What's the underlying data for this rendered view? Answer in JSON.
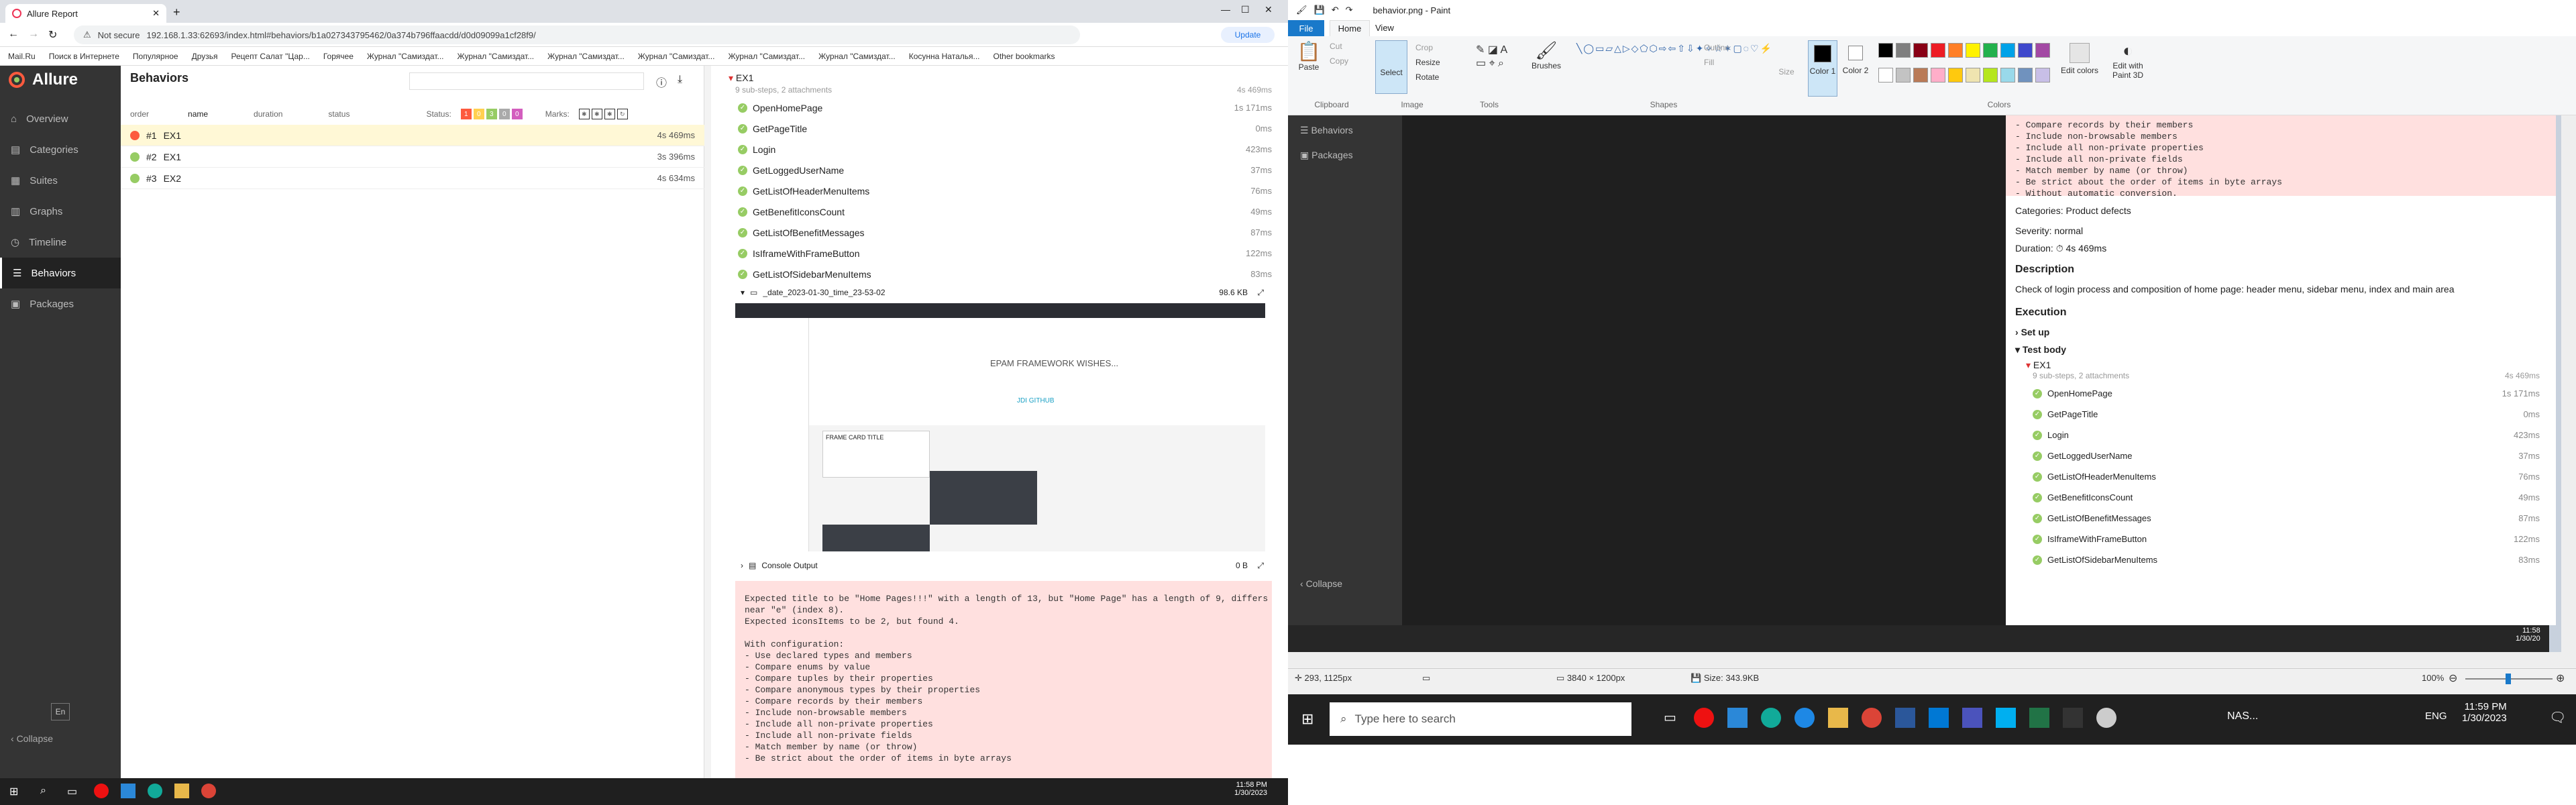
{
  "browser": {
    "tab_title": "Allure Report",
    "url_prefix": "Not secure",
    "url": "192.168.1.33:62693/index.html#behaviors/b1a027343795462/0a374b796ffaacdd/d0d09099a1cf28f9/",
    "update_label": "Update",
    "bookmarks": [
      "Mail.Ru",
      "Поиск в Интернете",
      "Популярное",
      "Друзья",
      "Рецепт Салат \"Цар...",
      "Горячее",
      "Журнал \"Самиздат...",
      "Журнал \"Самиздат...",
      "Журнал \"Самиздат...",
      "Журнал \"Самиздат...",
      "Журнал \"Самиздат...",
      "Журнал \"Самиздат...",
      "Косунна Наталья...",
      "Other bookmarks"
    ]
  },
  "allure": {
    "brand": "Allure",
    "nav": [
      "Overview",
      "Categories",
      "Suites",
      "Graphs",
      "Timeline",
      "Behaviors",
      "Packages"
    ],
    "active_nav": "Behaviors",
    "lang": "En",
    "collapse": "Collapse",
    "behaviors_title": "Behaviors",
    "headers": {
      "order": "order",
      "name": "name",
      "duration": "duration",
      "status": "status"
    },
    "status_label": "Status:",
    "status_counts": [
      "1",
      "0",
      "3",
      "0",
      "0"
    ],
    "marks_label": "Marks:",
    "rows": [
      {
        "num": "#1",
        "name": "EX1",
        "dur": "4s 469ms",
        "color": "#fd5a3e"
      },
      {
        "num": "#2",
        "name": "EX1",
        "dur": "3s 396ms",
        "color": "#97cc64"
      },
      {
        "num": "#3",
        "name": "EX2",
        "dur": "4s 634ms",
        "color": "#97cc64"
      }
    ]
  },
  "detail": {
    "title": "EX1",
    "sub": "9 sub-steps, 2 attachments",
    "total": "4s 469ms",
    "steps": [
      {
        "name": "OpenHomePage",
        "dur": "1s 171ms"
      },
      {
        "name": "GetPageTitle",
        "dur": "0ms"
      },
      {
        "name": "Login",
        "dur": "423ms"
      },
      {
        "name": "GetLoggedUserName",
        "dur": "37ms"
      },
      {
        "name": "GetListOfHeaderMenuItems",
        "dur": "76ms"
      },
      {
        "name": "GetBenefitIconsCount",
        "dur": "49ms"
      },
      {
        "name": "GetListOfBenefitMessages",
        "dur": "87ms"
      },
      {
        "name": "IsIframeWithFrameButton",
        "dur": "122ms"
      },
      {
        "name": "GetListOfSidebarMenuItems",
        "dur": "83ms"
      }
    ],
    "attachment": "_date_2023-01-30_time_23-53-02",
    "attachment_size": "98.6 KB",
    "console": "Console Output",
    "console_size": "0 B",
    "shot_banner": "EPAM FRAMEWORK WISHES...",
    "shot_link": "JDI GITHUB",
    "shot_card": "FRAME CARD TITLE",
    "error": "Expected title to be \"Home Pages!!!\" with a length of 13, but \"Home Page\" has a length of 9, differs\nnear \"e\" (index 8).\nExpected iconsItems to be 2, but found 4.\n\nWith configuration:\n- Use declared types and members\n- Compare enums by value\n- Compare tuples by their properties\n- Compare anonymous types by their properties\n- Compare records by their members\n- Include non-browsable members\n- Include all non-private properties\n- Include all non-private fields\n- Match member by name (or throw)\n- Be strict about the order of items in byte arrays"
  },
  "taskbar_left": {
    "time": "11:58 PM",
    "date": "1/30/2023"
  },
  "paint": {
    "title": "behavior.png - Paint",
    "tabs": [
      "File",
      "Home",
      "View"
    ],
    "groups": [
      "Clipboard",
      "Image",
      "Tools",
      "Shapes",
      "Colors"
    ],
    "tools": [
      "Paste",
      "Cut",
      "Copy",
      "Select",
      "Crop",
      "Resize",
      "Rotate",
      "Brushes",
      "Outline",
      "Fill",
      "Size",
      "Color 1",
      "Color 2",
      "Edit colors",
      "Edit with Paint 3D"
    ],
    "colors": [
      "#000000",
      "#7f7f7f",
      "#880015",
      "#ed1c24",
      "#ff7f27",
      "#fff200",
      "#22b14c",
      "#00a2e8",
      "#3f48cc",
      "#a349a4",
      "#ffffff",
      "#c3c3c3",
      "#b97a57",
      "#ffaec9",
      "#ffc90e",
      "#efe4b0",
      "#b5e61d",
      "#99d9ea",
      "#7092be",
      "#c8bfe7"
    ],
    "status_pos": "293, 1125px",
    "status_dims": "3840 × 1200px",
    "status_size": "Size: 343.9KB",
    "zoom": "100%",
    "inner_error": "- Compare records by their members\n- Include non-browsable members\n- Include all non-private properties\n- Include all non-private fields\n- Match member by name (or throw)\n- Be strict about the order of items in byte arrays\n- Without automatic conversion.",
    "categories": "Categories: Product defects",
    "severity": "Severity: normal",
    "duration": "Duration: ⏱ 4s 469ms",
    "description_h": "Description",
    "description": "Check of login process and composition of home page: header menu, sidebar menu, index and main area",
    "execution": "Execution",
    "setup": "Set up",
    "testbody": "Test body",
    "inner_nav": [
      "Behaviors",
      "Packages"
    ],
    "inner_collapse": "Collapse",
    "inner_time": "11:58",
    "inner_date": "1/30/20"
  },
  "taskbar_right": {
    "search": "Type here to search",
    "nas": "NAS...",
    "lang": "ENG",
    "time": "11:59 PM",
    "date": "1/30/2023"
  }
}
